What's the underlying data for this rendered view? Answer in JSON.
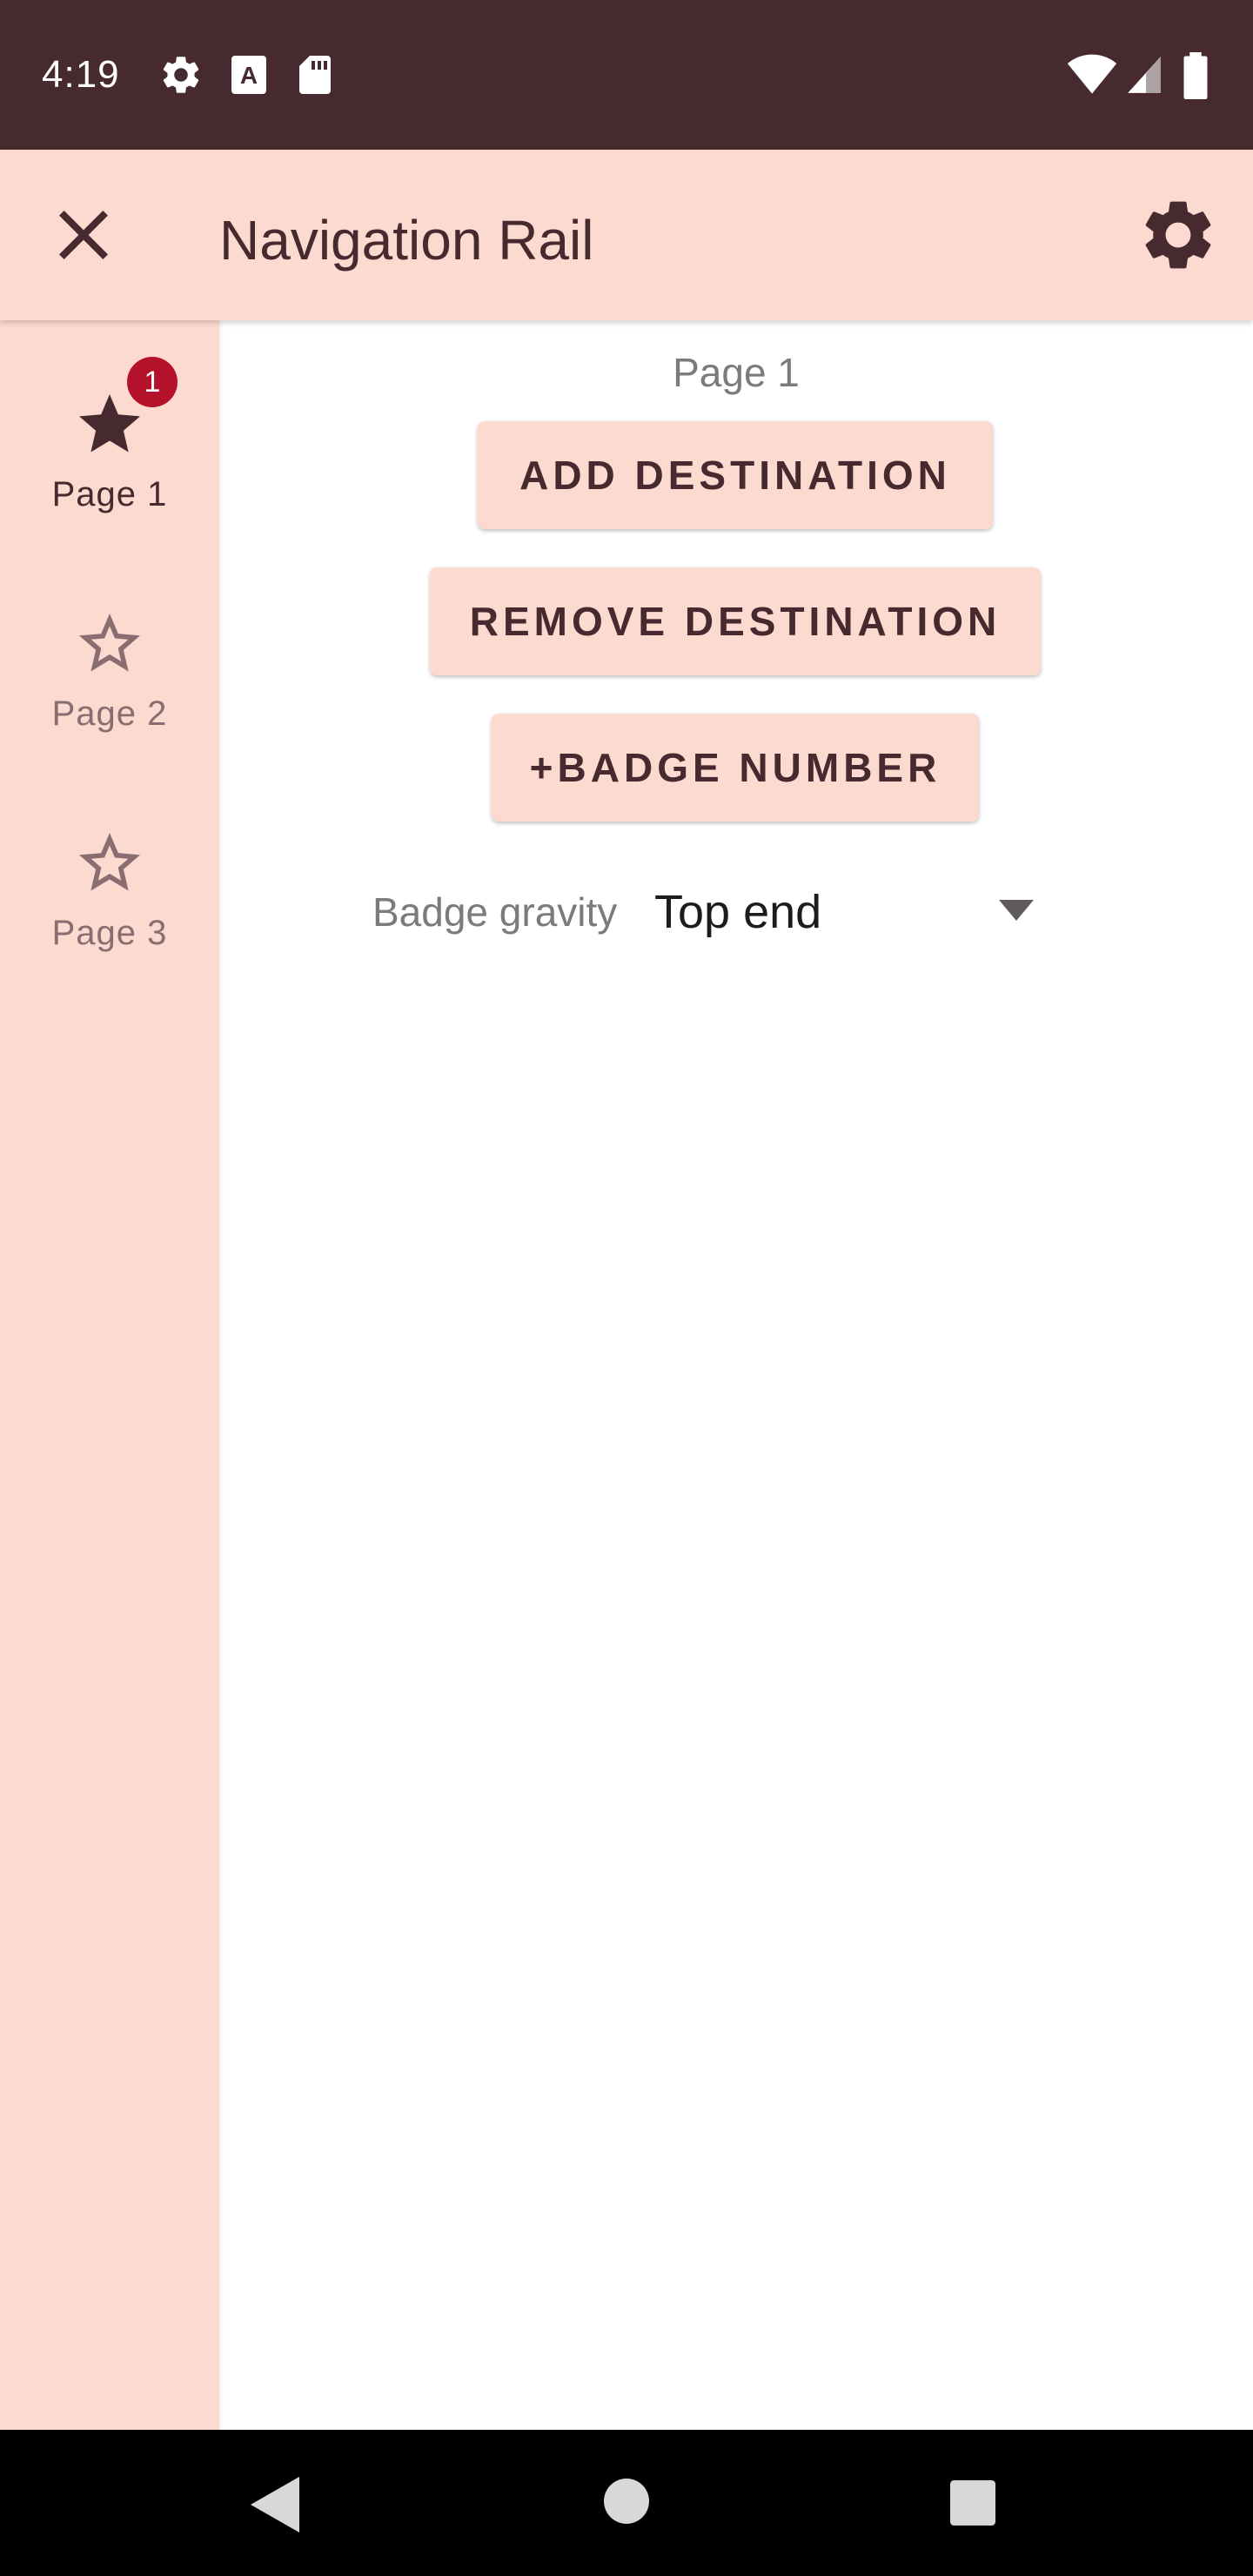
{
  "status_bar": {
    "time": "4:19",
    "icons": [
      "settings-icon",
      "a-keyboard-icon",
      "sd-card-icon",
      "wifi-icon",
      "signal-icon",
      "battery-icon"
    ]
  },
  "app_bar": {
    "title": "Navigation Rail",
    "close_icon": "close-icon",
    "settings_icon": "gear-icon"
  },
  "nav_rail": {
    "items": [
      {
        "label": "Page 1",
        "icon": "star-filled-icon",
        "selected": true,
        "badge": "1"
      },
      {
        "label": "Page 2",
        "icon": "star-outline-icon",
        "selected": false
      },
      {
        "label": "Page 3",
        "icon": "star-outline-icon",
        "selected": false
      }
    ]
  },
  "content": {
    "page_label": "Page 1",
    "buttons": {
      "add": "ADD DESTINATION",
      "remove": "REMOVE DESTINATION",
      "badge": "+BADGE NUMBER"
    },
    "gravity": {
      "label": "Badge gravity",
      "value": "Top end"
    }
  },
  "system_nav": {
    "icons": [
      "back-icon",
      "home-icon",
      "recents-icon"
    ]
  },
  "colors": {
    "status_bar": "#472a2f",
    "surface_pink": "#fddad0",
    "on_surface": "#472a2f",
    "badge": "#b3122a"
  }
}
